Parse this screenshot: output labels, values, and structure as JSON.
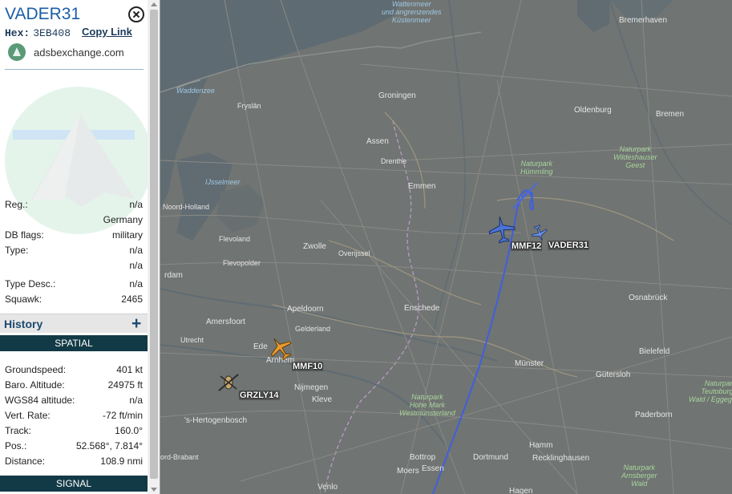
{
  "aircraft": {
    "callsign": "VADER31",
    "hex_label": "Hex:",
    "hex": "3EB408",
    "copy_link": "Copy Link",
    "source": "adsbexchange.com"
  },
  "details": [
    {
      "key": "Reg.:",
      "value": "n/a"
    },
    {
      "key": "",
      "value": "Germany"
    },
    {
      "key": "DB flags:",
      "value": "military"
    },
    {
      "key": "Type:",
      "value": "n/a"
    },
    {
      "key": "",
      "value": "n/a"
    },
    {
      "key": "Type Desc.:",
      "value": "n/a"
    },
    {
      "key": "Squawk:",
      "value": "2465"
    }
  ],
  "history": {
    "label": "History",
    "plus": "+"
  },
  "spatial_header": "SPATIAL",
  "spatial": [
    {
      "key": "Groundspeed:",
      "value": "401 kt"
    },
    {
      "key": "Baro. Altitude:",
      "value": "24975 ft"
    },
    {
      "key": "WGS84 altitude:",
      "value": "n/a"
    },
    {
      "key": "Vert. Rate:",
      "value": "-72 ft/min"
    },
    {
      "key": "Track:",
      "value": "160.0°"
    },
    {
      "key": "Pos.:",
      "value": "52.568°, 7.814°"
    },
    {
      "key": "Distance:",
      "value": "108.9 nmi"
    }
  ],
  "signal_header": "SIGNAL",
  "map": {
    "places": [
      {
        "name": "Wattenmeer\nund angrenzendes\nKüstenmeer",
        "style": "water"
      },
      {
        "name": "Waddenzee",
        "style": "water"
      },
      {
        "name": "Groningen",
        "style": "city"
      },
      {
        "name": "Fryslân",
        "style": ""
      },
      {
        "name": "Assen",
        "style": "city"
      },
      {
        "name": "Drenthe",
        "style": ""
      },
      {
        "name": "Emmen",
        "style": "city"
      },
      {
        "name": "IJsselmeer",
        "style": "water"
      },
      {
        "name": "Noord-Holland",
        "style": ""
      },
      {
        "name": "Flevoland",
        "style": ""
      },
      {
        "name": "Flevopolder",
        "style": ""
      },
      {
        "name": "Zwolle",
        "style": "city"
      },
      {
        "name": "Overijssel",
        "style": ""
      },
      {
        "name": "rdam",
        "style": "city"
      },
      {
        "name": "Apeldoorn",
        "style": "city"
      },
      {
        "name": "Gelderland",
        "style": ""
      },
      {
        "name": "Amersfoort",
        "style": "city"
      },
      {
        "name": "Utrecht",
        "style": ""
      },
      {
        "name": "Ede",
        "style": "city"
      },
      {
        "name": "Arnhem",
        "style": "city"
      },
      {
        "name": "Nijmegen",
        "style": "city"
      },
      {
        "name": "Kleve",
        "style": "city"
      },
      {
        "name": "'s-Hertogenbosch",
        "style": "city"
      },
      {
        "name": "ord-Brabant",
        "style": ""
      },
      {
        "name": "Enschede",
        "style": "city"
      },
      {
        "name": "Bremerhaven",
        "style": "city"
      },
      {
        "name": "Bremen",
        "style": "city"
      },
      {
        "name": "Oldenburg",
        "style": "city"
      },
      {
        "name": "Naturpark\nHümmling",
        "style": "green"
      },
      {
        "name": "Naturpark\nWildeshauser\nGeest",
        "style": "green"
      },
      {
        "name": "Osnabrück",
        "style": "city"
      },
      {
        "name": "Bielefeld",
        "style": "city"
      },
      {
        "name": "Münster",
        "style": "city"
      },
      {
        "name": "Gütersloh",
        "style": "city"
      },
      {
        "name": "Naturpark\nHohe Mark\nWestmünsterland",
        "style": "green"
      },
      {
        "name": "Hamm",
        "style": "city"
      },
      {
        "name": "Recklinghausen",
        "style": "city"
      },
      {
        "name": "Essen",
        "style": "city"
      },
      {
        "name": "Dortmund",
        "style": "city"
      },
      {
        "name": "Paderborn",
        "style": "city"
      },
      {
        "name": "Naturpark\nTeutoburger\nWald / Eggegebirge",
        "style": "green"
      },
      {
        "name": "Naturpark\nArnsberger\nWald",
        "style": "green"
      },
      {
        "name": "Moers",
        "style": "city"
      },
      {
        "name": "Venlo",
        "style": "city"
      },
      {
        "name": "Hagen",
        "style": "city"
      },
      {
        "name": "Bottrop",
        "style": "city"
      }
    ],
    "aircraft": [
      {
        "callsign": "MMF12",
        "color": "#4a74d6"
      },
      {
        "callsign": "VADER31",
        "color": "#5a86d8"
      },
      {
        "callsign": "MMF10",
        "color": "#e99a2f"
      },
      {
        "callsign": "GRZLY14",
        "color": "#c9a86a"
      }
    ],
    "track_color": "#3f5fe0"
  }
}
